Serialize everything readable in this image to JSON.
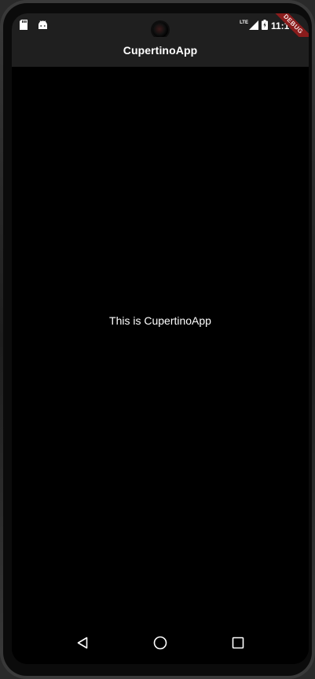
{
  "status_bar": {
    "time": "11:10",
    "network": "LTE",
    "icons": [
      "sd-card-icon",
      "android-icon",
      "lte-signal-icon",
      "battery-icon"
    ]
  },
  "app_bar": {
    "title": "CupertinoApp"
  },
  "debug_banner": {
    "label": "DEBUG",
    "color": "#8a1c1c"
  },
  "body": {
    "text": "This is CupertinoApp"
  },
  "nav_bar": {
    "buttons": [
      "back-icon",
      "home-icon",
      "recents-icon"
    ]
  },
  "colors": {
    "background": "#000000",
    "bar": "#1f1f1f",
    "text": "#ffffff"
  }
}
